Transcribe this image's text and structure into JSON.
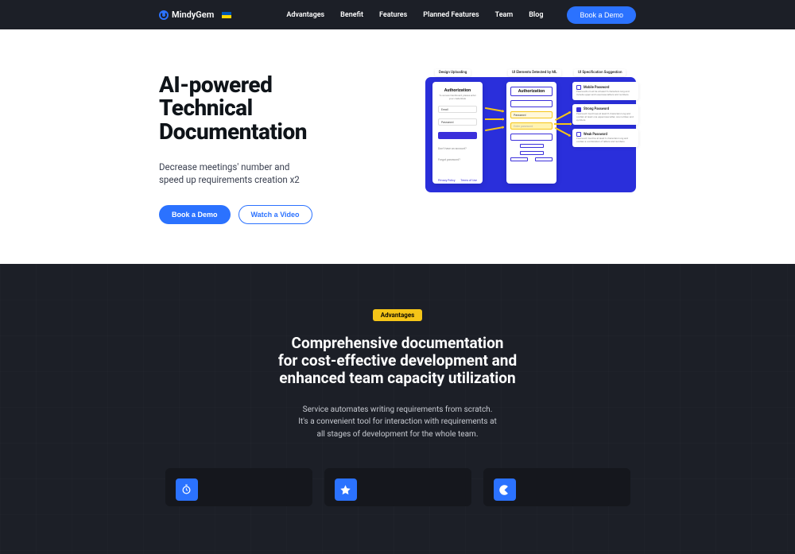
{
  "header": {
    "brand": "MindyGem",
    "nav": [
      "Advantages",
      "Benefit",
      "Features",
      "Planned Features",
      "Team",
      "Blog"
    ],
    "cta": "Book a Demo"
  },
  "hero": {
    "title_l1": "AI-powered",
    "title_l2": "Technical",
    "title_l3": "Documentation",
    "sub_l1": "Decrease meetings' number and",
    "sub_l2": "speed up requirements creation x2",
    "primary": "Book a Demo",
    "secondary": "Watch a Video"
  },
  "graphic": {
    "tag1": "Design Uploading",
    "tag2": "UI Elements Detected by ML",
    "tag3": "UI Specification Suggestion",
    "card1": {
      "title": "Authorization",
      "sub": "To access Dashboard, please enter your credentials",
      "field1": "Email",
      "field2": "Password",
      "link1": "Don't have an account?",
      "link2": "Forgot password?",
      "bl": "Privacy Policy",
      "br": "Terms of Use"
    },
    "card2": {
      "title": "Authorization",
      "pw": "Password",
      "hint": "Enter password"
    },
    "row1": {
      "t": "Mobile Password",
      "d": "Passwords must be at least 8 characters long and include upper and lowercase letters and numbers."
    },
    "row2": {
      "t": "Strong Password",
      "d": "Password must have at least 8 characters long and contain at least one uppercase letter, one number, and symbols."
    },
    "row3": {
      "t": "Weak Password",
      "d": "Password must be at least 6 characters long and contain a combination of letters and numbers."
    }
  },
  "advantages": {
    "badge": "Advantages",
    "title_l1": "Comprehensive documentation",
    "title_l2": "for cost-effective development and",
    "title_l3": "enhanced team capacity utilization",
    "sub_l1": "Service automates writing requirements from scratch.",
    "sub_l2": "It's a convenient tool for interaction with requirements at",
    "sub_l3": "all stages of development for the whole team."
  }
}
